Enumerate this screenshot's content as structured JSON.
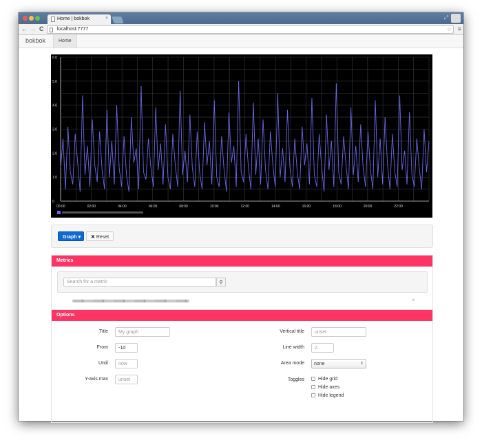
{
  "browser": {
    "tab_title": "Home | bokbok",
    "tab_close": "×",
    "url": "localhost:7777",
    "back": "←",
    "forward": "→",
    "reload": "C",
    "star_icon": "☆",
    "menu_icon": "≡"
  },
  "navbar": {
    "brand": "bokbok",
    "home": "Home"
  },
  "chart_data": {
    "type": "line",
    "title": "",
    "xlabel": "",
    "ylabel": "",
    "ylim": [
      0,
      6
    ],
    "yticks": [
      "0",
      "1.0",
      "2.0",
      "3.0",
      "4.0",
      "5.0",
      "6.0"
    ],
    "xticks": [
      "00:00",
      "02:00",
      "04:00",
      "06:00",
      "08:00",
      "10:00",
      "12:00",
      "14:00",
      "16:00",
      "18:00",
      "20:00",
      "22:00"
    ],
    "grid": true,
    "legend": "bottom-left",
    "background": "#000000",
    "series_color": "#6a6ae8",
    "series": [
      {
        "values": [
          1.4,
          2.6,
          0.5,
          3.1,
          1.2,
          0.7,
          2.8,
          1.6,
          0.4,
          4.4,
          1.1,
          2.3,
          0.6,
          3.4,
          1.5,
          0.8,
          2.9,
          1.3,
          0.5,
          3.8,
          1.0,
          2.5,
          0.7,
          4.0,
          1.4,
          0.6,
          2.7,
          1.1,
          0.4,
          3.5,
          1.6,
          2.2,
          0.5,
          4.8,
          1.2,
          0.9,
          2.6,
          1.4,
          0.6,
          3.9,
          1.3,
          2.4,
          0.7,
          3.2,
          1.0,
          0.5,
          2.8,
          1.5,
          0.6,
          4.6,
          1.1,
          2.1,
          0.8,
          3.6,
          1.4,
          0.6,
          2.9,
          1.2,
          0.5,
          3.3,
          1.5,
          2.5,
          0.7,
          4.2,
          1.0,
          0.6,
          2.7,
          1.3,
          0.4,
          3.7,
          1.6,
          2.3,
          0.6,
          5.0,
          1.2,
          0.8,
          2.8,
          1.4,
          0.5,
          4.1,
          1.1,
          2.6,
          0.7,
          3.4,
          1.3,
          0.5,
          2.9,
          1.5,
          0.6,
          4.5,
          1.0,
          2.2,
          0.8,
          3.8,
          1.4,
          0.6,
          2.6,
          1.2,
          0.5,
          3.1,
          1.5,
          2.4,
          0.7,
          4.3,
          1.1,
          0.6,
          2.8,
          1.4,
          0.4,
          3.6,
          1.3,
          2.5,
          0.6,
          4.9,
          1.2,
          0.7,
          2.7,
          1.5,
          0.5,
          3.9,
          1.1,
          2.3,
          0.8,
          3.2,
          1.4,
          0.6,
          2.9,
          1.3,
          0.5,
          4.2,
          1.0,
          2.6,
          0.7,
          3.5,
          1.5,
          0.5,
          2.8,
          1.2,
          0.6,
          4.4,
          1.3,
          2.1,
          0.7,
          3.7,
          1.1,
          0.6,
          2.6,
          1.4,
          0.5,
          3.0,
          1.2,
          2.5
        ]
      }
    ]
  },
  "controls": {
    "graph_button": "Graph",
    "graph_caret": "▾",
    "reset_button": "Reset",
    "reset_icon": "✖"
  },
  "metrics": {
    "heading": "Metrics",
    "search_placeholder": "Search for a metric",
    "search_icon": "⚲",
    "remove_icon": "×"
  },
  "options": {
    "heading": "Options",
    "title_label": "Title",
    "title_placeholder": "My graph",
    "from_label": "From",
    "from_value": "-1d",
    "until_label": "Until",
    "until_placeholder": "now",
    "ymax_label": "Y-axis max",
    "ymax_placeholder": "unset",
    "vtitle_label": "Vertical title",
    "vtitle_placeholder": "unset",
    "linewidth_label": "Line width",
    "linewidth_value": "2",
    "areamode_label": "Area mode",
    "areamode_value": "none",
    "areamode_arrow": "⇕",
    "toggles_label": "Toggles",
    "toggle_hide_grid": "Hide grid",
    "toggle_hide_axes": "Hide axes",
    "toggle_hide_legend": "Hide legend"
  }
}
